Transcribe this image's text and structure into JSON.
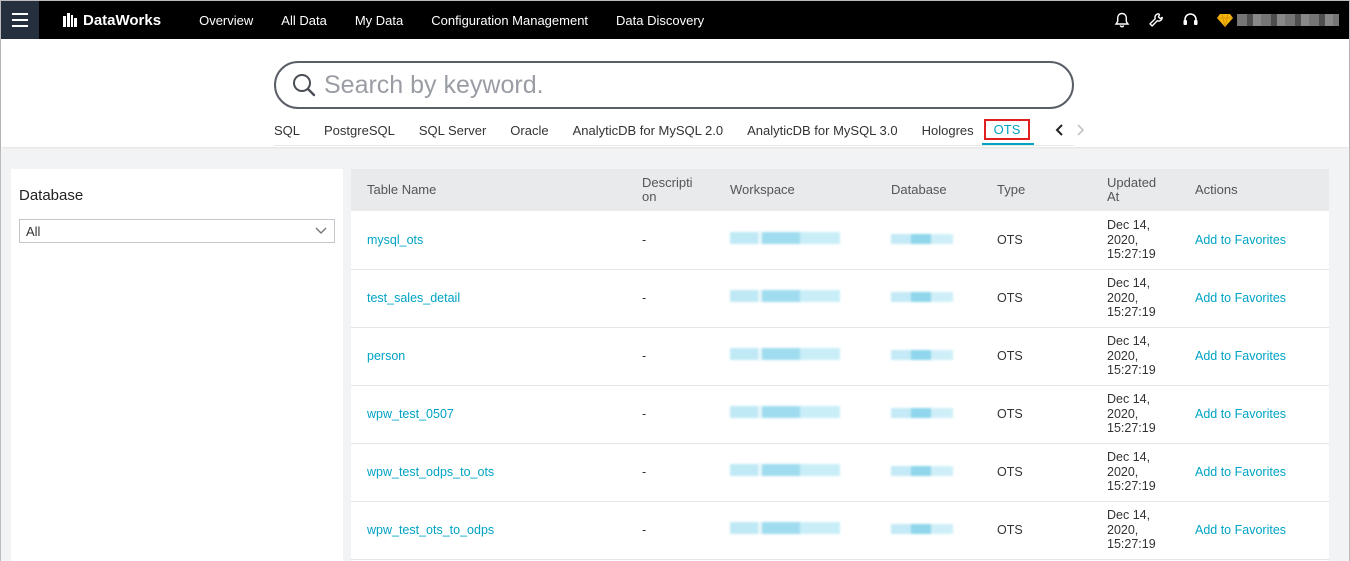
{
  "topbar": {
    "brand": "DataWorks",
    "nav": [
      "Overview",
      "All Data",
      "My Data",
      "Configuration Management",
      "Data Discovery"
    ]
  },
  "search": {
    "placeholder": "Search by keyword."
  },
  "tabs": [
    "SQL",
    "PostgreSQL",
    "SQL Server",
    "Oracle",
    "AnalyticDB for MySQL 2.0",
    "AnalyticDB for MySQL 3.0",
    "Hologres"
  ],
  "active_tab": "OTS",
  "sidebar": {
    "title": "Database",
    "select_value": "All"
  },
  "table": {
    "headers": [
      "Table Name",
      "Descripti on",
      "Workspace",
      "Database",
      "Type",
      "Updated At",
      "Actions"
    ],
    "rows": [
      {
        "name": "mysql_ots",
        "description": "-",
        "type": "OTS",
        "updated": "Dec 14, 2020, 15:27:19",
        "action": "Add to Favorites"
      },
      {
        "name": "test_sales_detail",
        "description": "-",
        "type": "OTS",
        "updated": "Dec 14, 2020, 15:27:19",
        "action": "Add to Favorites"
      },
      {
        "name": "person",
        "description": "-",
        "type": "OTS",
        "updated": "Dec 14, 2020, 15:27:19",
        "action": "Add to Favorites"
      },
      {
        "name": "wpw_test_0507",
        "description": "-",
        "type": "OTS",
        "updated": "Dec 14, 2020, 15:27:19",
        "action": "Add to Favorites"
      },
      {
        "name": "wpw_test_odps_to_ots",
        "description": "-",
        "type": "OTS",
        "updated": "Dec 14, 2020, 15:27:19",
        "action": "Add to Favorites"
      },
      {
        "name": "wpw_test_ots_to_odps",
        "description": "-",
        "type": "OTS",
        "updated": "Dec 14, 2020, 15:27:19",
        "action": "Add to Favorites"
      }
    ]
  },
  "icons": [
    "menu-icon",
    "dataworks-logo-icon",
    "bell-icon",
    "wrench-icon",
    "headset-icon",
    "diamond-icon",
    "search-icon",
    "chevron-left-icon",
    "chevron-right-icon",
    "chevron-down-icon"
  ],
  "colors": {
    "accent": "#00a3c4",
    "highlight_box": "#e02020",
    "topbar": "#000000",
    "diamond": "#f5b50a"
  }
}
